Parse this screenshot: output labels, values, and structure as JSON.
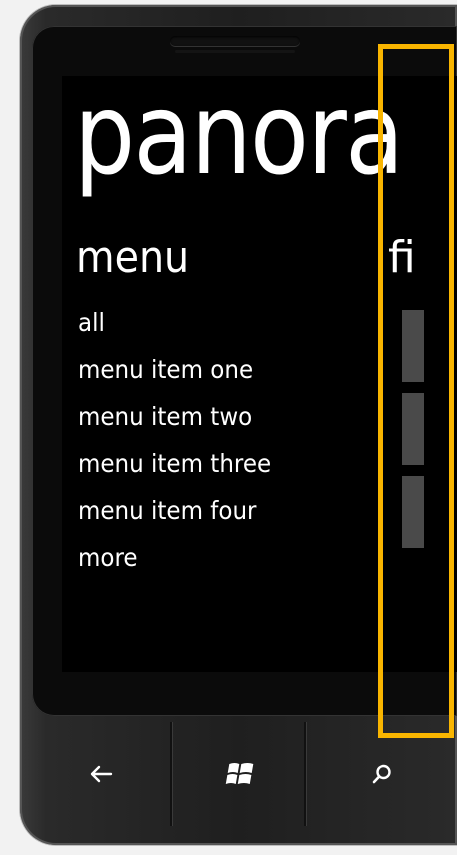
{
  "panorama": {
    "title": "panora",
    "section_title": "menu",
    "next_section_title": "fi",
    "menu_items": [
      "all",
      "menu item one",
      "menu item two",
      "menu item three",
      "menu item four",
      "more"
    ]
  },
  "colors": {
    "accent_highlight": "#f9b500",
    "screen_background": "#000000",
    "text": "#ffffff",
    "tile": "#4a4a4a"
  },
  "hardware_buttons": {
    "back": "back-arrow-icon",
    "start": "windows-logo-icon",
    "search": "search-icon"
  }
}
